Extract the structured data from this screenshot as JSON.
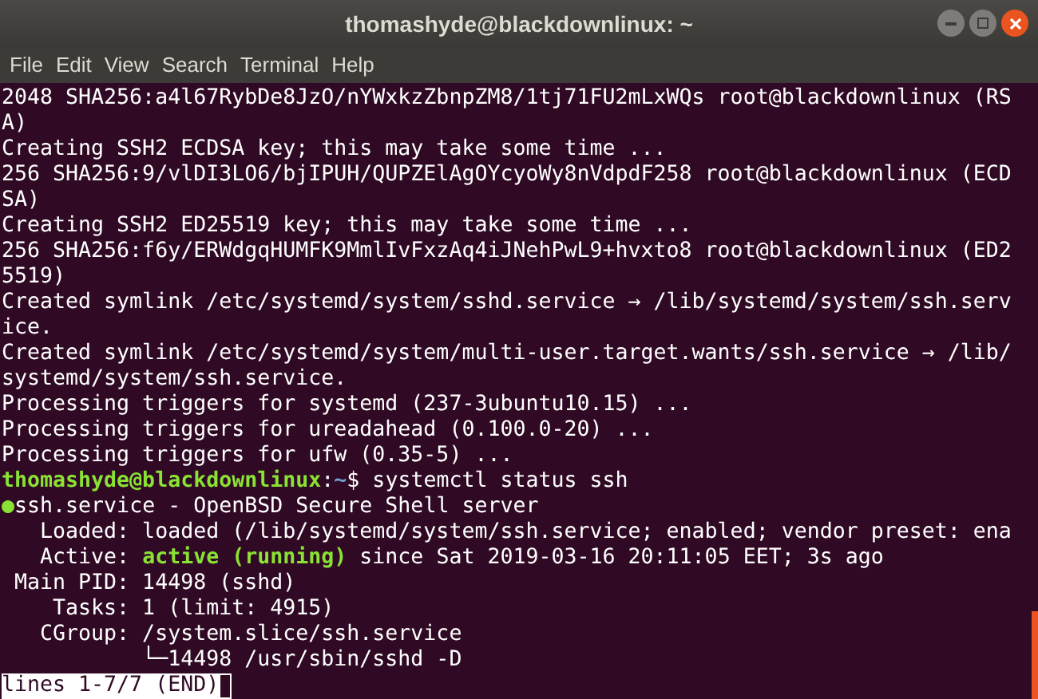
{
  "window": {
    "title": "thomashyde@blackdownlinux: ~"
  },
  "menu": [
    "File",
    "Edit",
    "View",
    "Search",
    "Terminal",
    "Help"
  ],
  "lines": [
    {
      "segments": [
        {
          "kind": "plain",
          "text": "2048 SHA256:a4l67RybDe8JzO/nYWxkzZbnpZM8/1tj71FU2mLxWQs root@blackdownlinux (RS"
        }
      ]
    },
    {
      "segments": [
        {
          "kind": "plain",
          "text": "A)"
        }
      ]
    },
    {
      "segments": [
        {
          "kind": "plain",
          "text": "Creating SSH2 ECDSA key; this may take some time ..."
        }
      ]
    },
    {
      "segments": [
        {
          "kind": "plain",
          "text": "256 SHA256:9/vlDI3LO6/bjIPUH/QUPZElAgOYcyoWy8nVdpdF258 root@blackdownlinux (ECD"
        }
      ]
    },
    {
      "segments": [
        {
          "kind": "plain",
          "text": "SA)"
        }
      ]
    },
    {
      "segments": [
        {
          "kind": "plain",
          "text": "Creating SSH2 ED25519 key; this may take some time ..."
        }
      ]
    },
    {
      "segments": [
        {
          "kind": "plain",
          "text": "256 SHA256:f6y/ERWdgqHUMFK9MmlIvFxzAq4iJNehPwL9+hvxto8 root@blackdownlinux (ED2"
        }
      ]
    },
    {
      "segments": [
        {
          "kind": "plain",
          "text": "5519)"
        }
      ]
    },
    {
      "segments": [
        {
          "kind": "plain",
          "text": "Created symlink /etc/systemd/system/sshd.service → /lib/systemd/system/ssh.serv"
        }
      ]
    },
    {
      "segments": [
        {
          "kind": "plain",
          "text": "ice."
        }
      ]
    },
    {
      "segments": [
        {
          "kind": "plain",
          "text": "Created symlink /etc/systemd/system/multi-user.target.wants/ssh.service → /lib/"
        }
      ]
    },
    {
      "segments": [
        {
          "kind": "plain",
          "text": "systemd/system/ssh.service."
        }
      ]
    },
    {
      "segments": [
        {
          "kind": "plain",
          "text": "Processing triggers for systemd (237-3ubuntu10.15) ..."
        }
      ]
    },
    {
      "segments": [
        {
          "kind": "plain",
          "text": "Processing triggers for ureadahead (0.100.0-20) ..."
        }
      ]
    },
    {
      "segments": [
        {
          "kind": "plain",
          "text": "Processing triggers for ufw (0.35-5) ..."
        }
      ]
    },
    {
      "segments": [
        {
          "kind": "host",
          "text": "thomashyde@blackdownlinux"
        },
        {
          "kind": "plain",
          "text": ":"
        },
        {
          "kind": "path",
          "text": "~"
        },
        {
          "kind": "plain",
          "text": "$ systemctl status ssh"
        }
      ]
    },
    {
      "segments": [
        {
          "kind": "dot",
          "text": "●"
        },
        {
          "kind": "plain",
          "text": "ssh.service - OpenBSD Secure Shell server"
        }
      ]
    },
    {
      "segments": [
        {
          "kind": "plain",
          "text": "   Loaded: loaded (/lib/systemd/system/ssh.service; enabled; vendor preset: ena"
        }
      ]
    },
    {
      "segments": [
        {
          "kind": "plain",
          "text": "   Active: "
        },
        {
          "kind": "ok",
          "text": "active (running)"
        },
        {
          "kind": "plain",
          "text": " since Sat 2019-03-16 20:11:05 EET; 3s ago"
        }
      ]
    },
    {
      "segments": [
        {
          "kind": "plain",
          "text": " Main PID: 14498 (sshd)"
        }
      ]
    },
    {
      "segments": [
        {
          "kind": "plain",
          "text": "    Tasks: 1 (limit: 4915)"
        }
      ]
    },
    {
      "segments": [
        {
          "kind": "plain",
          "text": "   CGroup: /system.slice/ssh.service"
        }
      ]
    },
    {
      "segments": [
        {
          "kind": "plain",
          "text": "           └─14498 /usr/sbin/sshd -D"
        }
      ]
    },
    {
      "segments": [
        {
          "kind": "inverse",
          "text": "lines 1-7/7 (END)"
        }
      ],
      "cursor": true
    }
  ]
}
